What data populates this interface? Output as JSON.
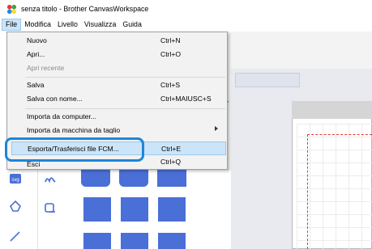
{
  "window": {
    "title": "senza titolo - Brother CanvasWorkspace",
    "app_icon": "canvasworkspace-icon"
  },
  "menubar": {
    "items": [
      "File",
      "Modifica",
      "Livello",
      "Visualizza",
      "Guida"
    ],
    "active": "File"
  },
  "file_menu": {
    "items": [
      {
        "label": "Nuovo",
        "shortcut": "Ctrl+N",
        "enabled": true
      },
      {
        "label": "Apri...",
        "shortcut": "Ctrl+O",
        "enabled": true
      },
      {
        "label": "Apri recente",
        "shortcut": "",
        "enabled": false
      },
      {
        "label": "Salva",
        "shortcut": "Ctrl+S",
        "enabled": true
      },
      {
        "label": "Salva con nome...",
        "shortcut": "Ctrl+MAIUSC+S",
        "enabled": true
      },
      {
        "label": "Importa da computer...",
        "shortcut": "",
        "enabled": true
      },
      {
        "label": "Importa da macchina da taglio",
        "shortcut": "",
        "enabled": true,
        "submenu": true
      },
      {
        "label": "Esporta/Trasferisci file FCM...",
        "shortcut": "Ctrl+E",
        "enabled": true,
        "highlighted": true
      },
      {
        "label": "Esci",
        "shortcut": "Ctrl+Q",
        "enabled": true
      }
    ]
  },
  "highlight_color": "#1d86d9",
  "accent_color": "#4a6fd6",
  "side_icons": [
    "svg-icon",
    "shape-icon",
    "line-icon"
  ]
}
